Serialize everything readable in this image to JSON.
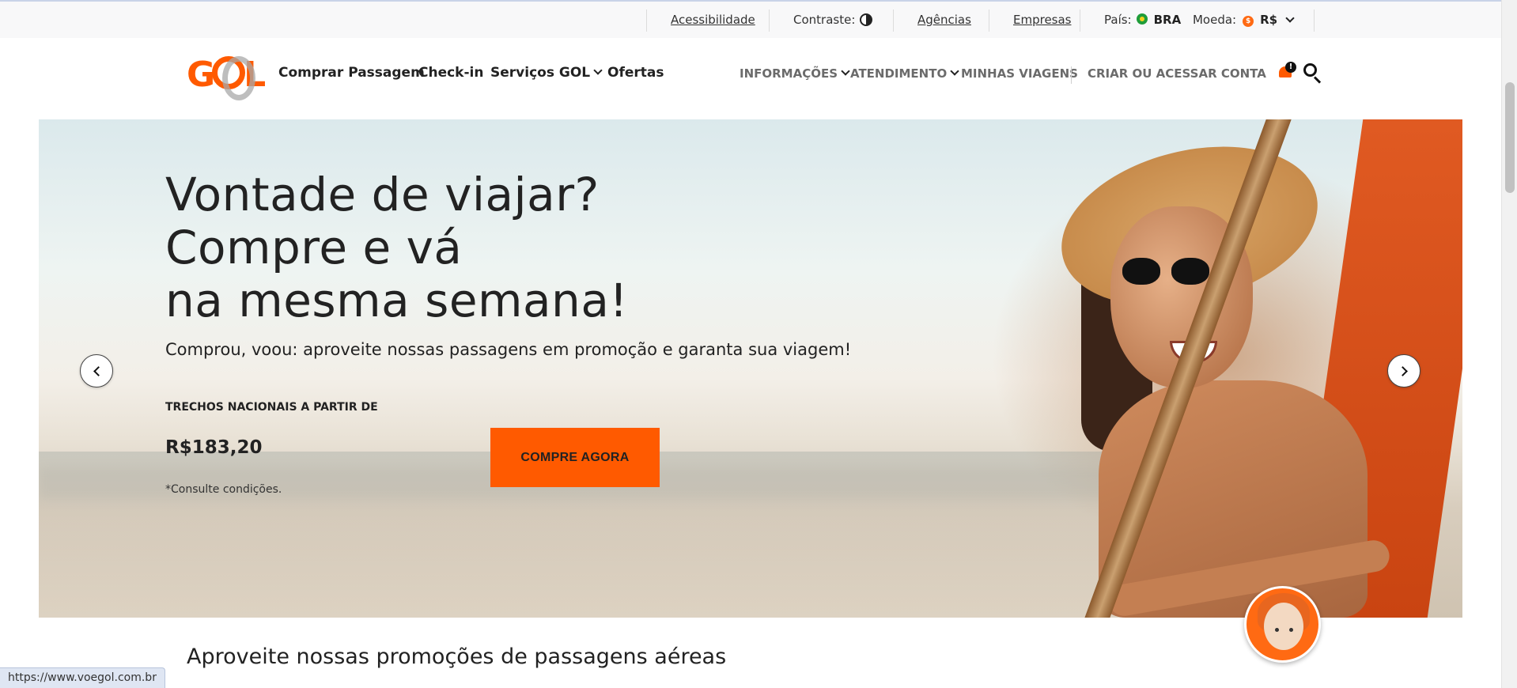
{
  "topbar": {
    "accessibility": "Acessibilidade",
    "contrast_label": "Contraste:",
    "agencies": "Agências",
    "companies": "Empresas",
    "country_label": "País:",
    "country_value": "BRA",
    "currency_label": "Moeda:",
    "currency_symbol": "$",
    "currency_value": "R$"
  },
  "nav": {
    "logo": "GOL",
    "buy": "Comprar Passagem",
    "checkin": "Check-in",
    "services": "Serviços GOL",
    "offers": "Ofertas",
    "info": "INFORMAÇÕES",
    "support": "ATENDIMENTO",
    "trips": "MINHAS VIAGENS",
    "account": "CRIAR OU ACESSAR CONTA",
    "notification_badge": "!"
  },
  "hero": {
    "title_lines": [
      "Vontade de viajar?",
      "Compre e vá",
      "na mesma semana!"
    ],
    "subtitle": "Comprou, voou: aproveite nossas passagens em promoção e garanta sua viagem!",
    "from_label": "TRECHOS NACIONAIS A PARTIR DE",
    "price": "R$183,20",
    "note": "*Consulte condições.",
    "cta": "COMPRE AGORA"
  },
  "promo": {
    "title": "Aproveite nossas promoções de passagens aéreas"
  },
  "statusbar": {
    "url": "https://www.voegol.com.br"
  },
  "colors": {
    "brand": "#ff5a00",
    "text": "#222222"
  }
}
